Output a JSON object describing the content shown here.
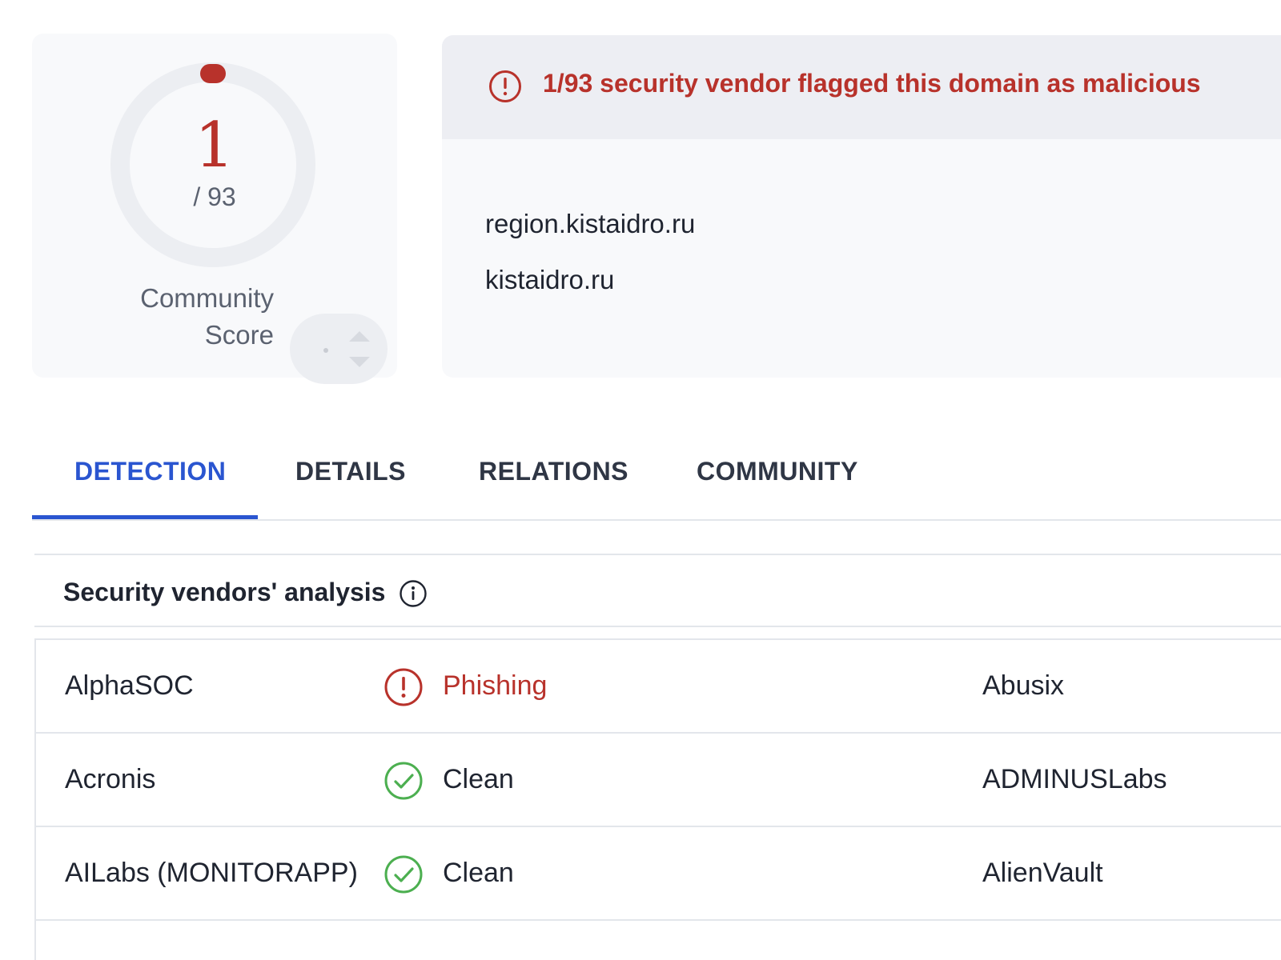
{
  "score": {
    "detections": "1",
    "total": "/ 93",
    "community_label_line1": "Community",
    "community_label_line2": "Score"
  },
  "banner": {
    "text": "1/93 security vendor flagged this domain as malicious",
    "icon": "alert-circle-icon",
    "color": "#b8322b"
  },
  "domains": [
    "region.kistaidro.ru",
    "kistaidro.ru"
  ],
  "tabs": [
    {
      "label": "DETECTION",
      "active": true
    },
    {
      "label": "DETAILS",
      "active": false
    },
    {
      "label": "RELATIONS",
      "active": false
    },
    {
      "label": "COMMUNITY",
      "active": false
    }
  ],
  "section": {
    "title": "Security vendors' analysis",
    "info_icon": "info-icon"
  },
  "vendors": [
    {
      "name": "AlphaSOC",
      "result": "Phishing",
      "result_icon": "alert-circle-icon",
      "other_vendor": "Abusix"
    },
    {
      "name": "Acronis",
      "result": "Clean",
      "result_icon": "check-circle-icon",
      "other_vendor": "ADMINUSLabs"
    },
    {
      "name": "AILabs (MONITORAPP)",
      "result": "Clean",
      "result_icon": "check-circle-icon",
      "other_vendor": "AlienVault"
    }
  ],
  "colors": {
    "malicious": "#b8322b",
    "clean": "#4caf50",
    "accent": "#2a55d0"
  }
}
